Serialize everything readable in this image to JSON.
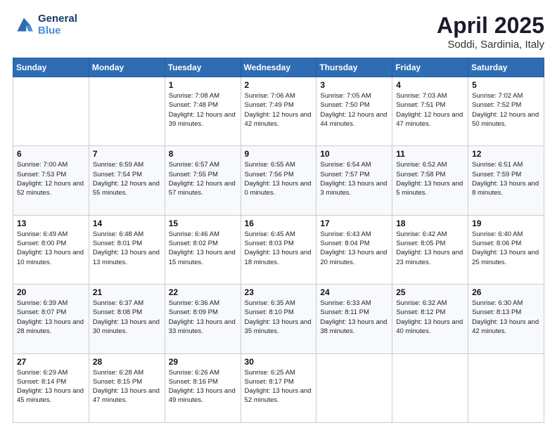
{
  "header": {
    "logo_line1": "General",
    "logo_line2": "Blue",
    "title": "April 2025",
    "subtitle": "Soddi, Sardinia, Italy"
  },
  "weekdays": [
    "Sunday",
    "Monday",
    "Tuesday",
    "Wednesday",
    "Thursday",
    "Friday",
    "Saturday"
  ],
  "rows": [
    [
      {
        "day": "",
        "info": ""
      },
      {
        "day": "",
        "info": ""
      },
      {
        "day": "1",
        "info": "Sunrise: 7:08 AM\nSunset: 7:48 PM\nDaylight: 12 hours and 39 minutes."
      },
      {
        "day": "2",
        "info": "Sunrise: 7:06 AM\nSunset: 7:49 PM\nDaylight: 12 hours and 42 minutes."
      },
      {
        "day": "3",
        "info": "Sunrise: 7:05 AM\nSunset: 7:50 PM\nDaylight: 12 hours and 44 minutes."
      },
      {
        "day": "4",
        "info": "Sunrise: 7:03 AM\nSunset: 7:51 PM\nDaylight: 12 hours and 47 minutes."
      },
      {
        "day": "5",
        "info": "Sunrise: 7:02 AM\nSunset: 7:52 PM\nDaylight: 12 hours and 50 minutes."
      }
    ],
    [
      {
        "day": "6",
        "info": "Sunrise: 7:00 AM\nSunset: 7:53 PM\nDaylight: 12 hours and 52 minutes."
      },
      {
        "day": "7",
        "info": "Sunrise: 6:59 AM\nSunset: 7:54 PM\nDaylight: 12 hours and 55 minutes."
      },
      {
        "day": "8",
        "info": "Sunrise: 6:57 AM\nSunset: 7:55 PM\nDaylight: 12 hours and 57 minutes."
      },
      {
        "day": "9",
        "info": "Sunrise: 6:55 AM\nSunset: 7:56 PM\nDaylight: 13 hours and 0 minutes."
      },
      {
        "day": "10",
        "info": "Sunrise: 6:54 AM\nSunset: 7:57 PM\nDaylight: 13 hours and 3 minutes."
      },
      {
        "day": "11",
        "info": "Sunrise: 6:52 AM\nSunset: 7:58 PM\nDaylight: 13 hours and 5 minutes."
      },
      {
        "day": "12",
        "info": "Sunrise: 6:51 AM\nSunset: 7:59 PM\nDaylight: 13 hours and 8 minutes."
      }
    ],
    [
      {
        "day": "13",
        "info": "Sunrise: 6:49 AM\nSunset: 8:00 PM\nDaylight: 13 hours and 10 minutes."
      },
      {
        "day": "14",
        "info": "Sunrise: 6:48 AM\nSunset: 8:01 PM\nDaylight: 13 hours and 13 minutes."
      },
      {
        "day": "15",
        "info": "Sunrise: 6:46 AM\nSunset: 8:02 PM\nDaylight: 13 hours and 15 minutes."
      },
      {
        "day": "16",
        "info": "Sunrise: 6:45 AM\nSunset: 8:03 PM\nDaylight: 13 hours and 18 minutes."
      },
      {
        "day": "17",
        "info": "Sunrise: 6:43 AM\nSunset: 8:04 PM\nDaylight: 13 hours and 20 minutes."
      },
      {
        "day": "18",
        "info": "Sunrise: 6:42 AM\nSunset: 8:05 PM\nDaylight: 13 hours and 23 minutes."
      },
      {
        "day": "19",
        "info": "Sunrise: 6:40 AM\nSunset: 8:06 PM\nDaylight: 13 hours and 25 minutes."
      }
    ],
    [
      {
        "day": "20",
        "info": "Sunrise: 6:39 AM\nSunset: 8:07 PM\nDaylight: 13 hours and 28 minutes."
      },
      {
        "day": "21",
        "info": "Sunrise: 6:37 AM\nSunset: 8:08 PM\nDaylight: 13 hours and 30 minutes."
      },
      {
        "day": "22",
        "info": "Sunrise: 6:36 AM\nSunset: 8:09 PM\nDaylight: 13 hours and 33 minutes."
      },
      {
        "day": "23",
        "info": "Sunrise: 6:35 AM\nSunset: 8:10 PM\nDaylight: 13 hours and 35 minutes."
      },
      {
        "day": "24",
        "info": "Sunrise: 6:33 AM\nSunset: 8:11 PM\nDaylight: 13 hours and 38 minutes."
      },
      {
        "day": "25",
        "info": "Sunrise: 6:32 AM\nSunset: 8:12 PM\nDaylight: 13 hours and 40 minutes."
      },
      {
        "day": "26",
        "info": "Sunrise: 6:30 AM\nSunset: 8:13 PM\nDaylight: 13 hours and 42 minutes."
      }
    ],
    [
      {
        "day": "27",
        "info": "Sunrise: 6:29 AM\nSunset: 8:14 PM\nDaylight: 13 hours and 45 minutes."
      },
      {
        "day": "28",
        "info": "Sunrise: 6:28 AM\nSunset: 8:15 PM\nDaylight: 13 hours and 47 minutes."
      },
      {
        "day": "29",
        "info": "Sunrise: 6:26 AM\nSunset: 8:16 PM\nDaylight: 13 hours and 49 minutes."
      },
      {
        "day": "30",
        "info": "Sunrise: 6:25 AM\nSunset: 8:17 PM\nDaylight: 13 hours and 52 minutes."
      },
      {
        "day": "",
        "info": ""
      },
      {
        "day": "",
        "info": ""
      },
      {
        "day": "",
        "info": ""
      }
    ]
  ]
}
